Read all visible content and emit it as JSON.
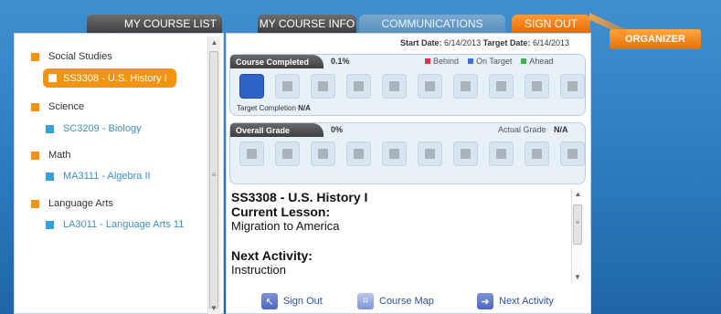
{
  "tabs": {
    "course_list": "MY COURSE LIST",
    "course_info": "MY COURSE INFO",
    "communications": "COMMUNICATIONS",
    "sign_out": "SIGN OUT",
    "organizer": "ORGANIZER"
  },
  "categories": [
    {
      "name": "Social Studies",
      "course": "SS3308 - U.S. History I",
      "selected": true
    },
    {
      "name": "Science",
      "course": "SC3209 - Biology",
      "selected": false
    },
    {
      "name": "Math",
      "course": "MA3111 - Algebra II",
      "selected": false
    },
    {
      "name": "Language Arts",
      "course": "LA3011 - Language Arts 11",
      "selected": false
    }
  ],
  "dates": {
    "start_label": "Start Date:",
    "start": "6/14/2013",
    "target_label": "Target Date:",
    "target": "6/14/2013"
  },
  "progress": {
    "label": "Course Completed",
    "value": "0.1%",
    "legend": [
      "Behind",
      "On Target",
      "Ahead"
    ],
    "legend_colors": [
      "#d9344a",
      "#3a6fdc",
      "#38b54a"
    ],
    "target_completion_label": "Target Completion",
    "target_completion": "N/A"
  },
  "grade": {
    "label": "Overall Grade",
    "value": "0%",
    "actual_label": "Actual Grade",
    "actual": "N/A"
  },
  "lesson": {
    "course": "SS3308 - U.S. History I",
    "current_label": "Current Lesson:",
    "current": "Migration to America",
    "next_label": "Next Activity:",
    "next": "Instruction"
  },
  "buttons": {
    "sign_out": "Sign Out",
    "course_map": "Course Map",
    "next_activity": "Next Activity"
  },
  "colors": {
    "accent_orange": "#f29410",
    "link_blue": "#3b8fc5",
    "active_cell": "#2e64c8"
  }
}
